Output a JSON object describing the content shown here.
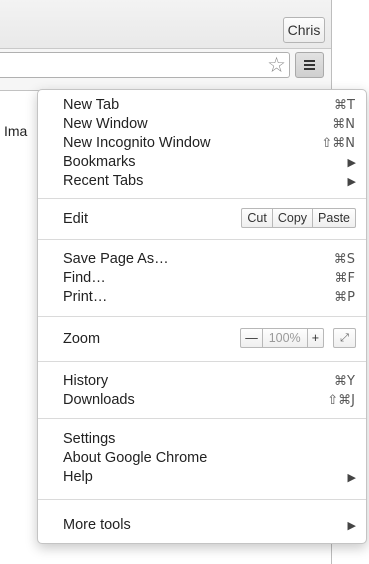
{
  "window": {
    "profile_name": "Chris"
  },
  "toolbar": {
    "bookmark_icon": "star-icon",
    "menu_icon": "hamburger-menu-icon"
  },
  "page": {
    "visible_text": "Ima"
  },
  "menu": {
    "group1": [
      {
        "label": "New Tab",
        "shortcut": "⌘T"
      },
      {
        "label": "New Window",
        "shortcut": "⌘N"
      },
      {
        "label": "New Incognito Window",
        "shortcut": "⇧⌘N"
      },
      {
        "label": "Bookmarks",
        "submenu": true
      },
      {
        "label": "Recent Tabs",
        "submenu": true
      }
    ],
    "edit": {
      "label": "Edit",
      "cut": "Cut",
      "copy": "Copy",
      "paste": "Paste"
    },
    "group2": [
      {
        "label": "Save Page As…",
        "shortcut": "⌘S"
      },
      {
        "label": "Find…",
        "shortcut": "⌘F"
      },
      {
        "label": "Print…",
        "shortcut": "⌘P"
      }
    ],
    "zoom": {
      "label": "Zoom",
      "minus": "—",
      "level": "100%",
      "plus": "+",
      "fullscreen": "⤢"
    },
    "group3": [
      {
        "label": "History",
        "shortcut": "⌘Y"
      },
      {
        "label": "Downloads",
        "shortcut": "⇧⌘J"
      }
    ],
    "group4": [
      {
        "label": "Settings"
      },
      {
        "label": "About Google Chrome"
      },
      {
        "label": "Help",
        "submenu": true
      }
    ],
    "group5": [
      {
        "label": "More tools",
        "submenu": true
      }
    ],
    "submenu_arrow": "▶"
  }
}
